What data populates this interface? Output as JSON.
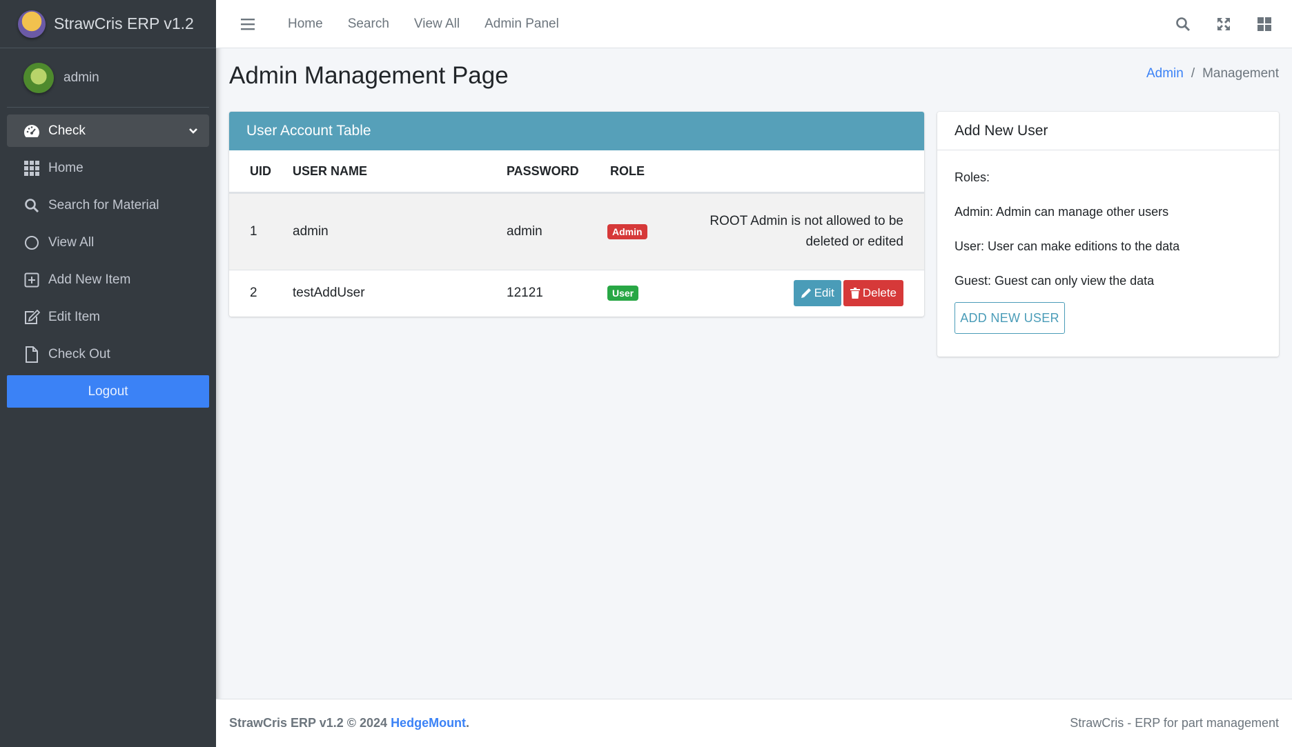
{
  "app": {
    "brand": "StrawCris ERP v1.2"
  },
  "sidebar": {
    "user": "admin",
    "items": [
      {
        "label": "Check",
        "icon": "dashboard-icon",
        "active": true
      },
      {
        "label": "Home",
        "icon": "grid-icon"
      },
      {
        "label": "Search for Material",
        "icon": "search-icon"
      },
      {
        "label": "View All",
        "icon": "circle-icon"
      },
      {
        "label": "Add New Item",
        "icon": "plus-square-icon"
      },
      {
        "label": "Edit Item",
        "icon": "edit-icon"
      },
      {
        "label": "Check Out",
        "icon": "file-icon"
      }
    ],
    "logout_label": "Logout"
  },
  "topbar": {
    "links": [
      "Home",
      "Search",
      "View All",
      "Admin Panel"
    ]
  },
  "page": {
    "title": "Admin Management Page",
    "breadcrumb": {
      "link": "Admin",
      "separator": "/",
      "active": "Management"
    }
  },
  "table": {
    "title": "User Account Table",
    "headers": [
      "UID",
      "USER NAME",
      "PASSWORD",
      "ROLE"
    ],
    "rows": [
      {
        "uid": "1",
        "name": "admin",
        "password": "admin",
        "role": "Admin",
        "note": "ROOT Admin is not allowed to be deleted or edited"
      },
      {
        "uid": "2",
        "name": "testAddUser",
        "password": "12121",
        "role": "User",
        "edit_label": "Edit",
        "delete_label": "Delete"
      }
    ]
  },
  "add_user": {
    "title": "Add New User",
    "roles_label": "Roles:",
    "admin_desc": "Admin: Admin can manage other users",
    "user_desc": "User: User can make editions to the data",
    "guest_desc": "Guest: Guest can only view the data",
    "button_label": "ADD NEW USER"
  },
  "footer": {
    "left_prefix": "StrawCris ERP v1.2 © 2024 ",
    "left_link": "HedgeMount",
    "left_suffix": ".",
    "right": "StrawCris - ERP for part management"
  },
  "colors": {
    "accent": "#3b82f6",
    "header_teal": "#56a0b9",
    "danger": "#d63939",
    "success": "#28a745",
    "sidebar": "#343a40"
  }
}
